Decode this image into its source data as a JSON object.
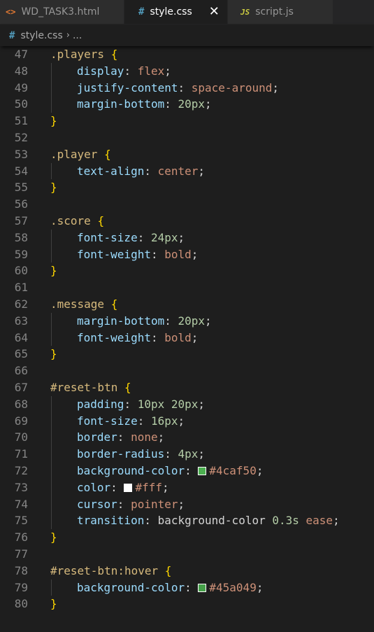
{
  "tabs": [
    {
      "label": "WD_TASK3.html",
      "icon": "html-file-icon",
      "icon_glyph": "<>",
      "active": false
    },
    {
      "label": "style.css",
      "icon": "css-file-icon",
      "icon_glyph": "#",
      "active": true,
      "close_glyph": "✕"
    },
    {
      "label": "script.js",
      "icon": "js-file-icon",
      "icon_glyph": "JS",
      "active": false
    }
  ],
  "breadcrumb": {
    "icon_glyph": "#",
    "file": "style.css",
    "separator": "›",
    "more": "..."
  },
  "lines": [
    {
      "n": "47",
      "tokens": [
        {
          "t": ".players",
          "c": "selector"
        },
        {
          "t": " ",
          "c": "punct"
        },
        {
          "t": "{",
          "c": "brace"
        }
      ]
    },
    {
      "n": "48",
      "indent": true,
      "tokens": [
        {
          "t": "display",
          "c": "prop"
        },
        {
          "t": ": ",
          "c": "punct"
        },
        {
          "t": "flex",
          "c": "val"
        },
        {
          "t": ";",
          "c": "punct"
        }
      ]
    },
    {
      "n": "49",
      "indent": true,
      "tokens": [
        {
          "t": "justify-content",
          "c": "prop"
        },
        {
          "t": ": ",
          "c": "punct"
        },
        {
          "t": "space-around",
          "c": "val"
        },
        {
          "t": ";",
          "c": "punct"
        }
      ]
    },
    {
      "n": "50",
      "indent": true,
      "tokens": [
        {
          "t": "margin-bottom",
          "c": "prop"
        },
        {
          "t": ": ",
          "c": "punct"
        },
        {
          "t": "20px",
          "c": "num"
        },
        {
          "t": ";",
          "c": "punct"
        }
      ]
    },
    {
      "n": "51",
      "tokens": [
        {
          "t": "}",
          "c": "brace"
        }
      ]
    },
    {
      "n": "52",
      "tokens": []
    },
    {
      "n": "53",
      "tokens": [
        {
          "t": ".player",
          "c": "selector"
        },
        {
          "t": " ",
          "c": "punct"
        },
        {
          "t": "{",
          "c": "brace"
        }
      ]
    },
    {
      "n": "54",
      "indent": true,
      "tokens": [
        {
          "t": "text-align",
          "c": "prop"
        },
        {
          "t": ": ",
          "c": "punct"
        },
        {
          "t": "center",
          "c": "val"
        },
        {
          "t": ";",
          "c": "punct"
        }
      ]
    },
    {
      "n": "55",
      "tokens": [
        {
          "t": "}",
          "c": "brace"
        }
      ]
    },
    {
      "n": "56",
      "tokens": []
    },
    {
      "n": "57",
      "tokens": [
        {
          "t": ".score",
          "c": "selector"
        },
        {
          "t": " ",
          "c": "punct"
        },
        {
          "t": "{",
          "c": "brace"
        }
      ]
    },
    {
      "n": "58",
      "indent": true,
      "tokens": [
        {
          "t": "font-size",
          "c": "prop"
        },
        {
          "t": ": ",
          "c": "punct"
        },
        {
          "t": "24px",
          "c": "num"
        },
        {
          "t": ";",
          "c": "punct"
        }
      ]
    },
    {
      "n": "59",
      "indent": true,
      "tokens": [
        {
          "t": "font-weight",
          "c": "prop"
        },
        {
          "t": ": ",
          "c": "punct"
        },
        {
          "t": "bold",
          "c": "val"
        },
        {
          "t": ";",
          "c": "punct"
        }
      ]
    },
    {
      "n": "60",
      "tokens": [
        {
          "t": "}",
          "c": "brace"
        }
      ]
    },
    {
      "n": "61",
      "tokens": []
    },
    {
      "n": "62",
      "tokens": [
        {
          "t": ".message",
          "c": "selector"
        },
        {
          "t": " ",
          "c": "punct"
        },
        {
          "t": "{",
          "c": "brace"
        }
      ]
    },
    {
      "n": "63",
      "indent": true,
      "tokens": [
        {
          "t": "margin-bottom",
          "c": "prop"
        },
        {
          "t": ": ",
          "c": "punct"
        },
        {
          "t": "20px",
          "c": "num"
        },
        {
          "t": ";",
          "c": "punct"
        }
      ]
    },
    {
      "n": "64",
      "indent": true,
      "tokens": [
        {
          "t": "font-weight",
          "c": "prop"
        },
        {
          "t": ": ",
          "c": "punct"
        },
        {
          "t": "bold",
          "c": "val"
        },
        {
          "t": ";",
          "c": "punct"
        }
      ]
    },
    {
      "n": "65",
      "tokens": [
        {
          "t": "}",
          "c": "brace"
        }
      ]
    },
    {
      "n": "66",
      "tokens": []
    },
    {
      "n": "67",
      "tokens": [
        {
          "t": "#reset-btn",
          "c": "selector"
        },
        {
          "t": " ",
          "c": "punct"
        },
        {
          "t": "{",
          "c": "brace"
        }
      ]
    },
    {
      "n": "68",
      "indent": true,
      "tokens": [
        {
          "t": "padding",
          "c": "prop"
        },
        {
          "t": ": ",
          "c": "punct"
        },
        {
          "t": "10px",
          "c": "num"
        },
        {
          "t": " ",
          "c": "punct"
        },
        {
          "t": "20px",
          "c": "num"
        },
        {
          "t": ";",
          "c": "punct"
        }
      ]
    },
    {
      "n": "69",
      "indent": true,
      "tokens": [
        {
          "t": "font-size",
          "c": "prop"
        },
        {
          "t": ": ",
          "c": "punct"
        },
        {
          "t": "16px",
          "c": "num"
        },
        {
          "t": ";",
          "c": "punct"
        }
      ]
    },
    {
      "n": "70",
      "indent": true,
      "tokens": [
        {
          "t": "border",
          "c": "prop"
        },
        {
          "t": ": ",
          "c": "punct"
        },
        {
          "t": "none",
          "c": "val"
        },
        {
          "t": ";",
          "c": "punct"
        }
      ]
    },
    {
      "n": "71",
      "indent": true,
      "tokens": [
        {
          "t": "border-radius",
          "c": "prop"
        },
        {
          "t": ": ",
          "c": "punct"
        },
        {
          "t": "4px",
          "c": "num"
        },
        {
          "t": ";",
          "c": "punct"
        }
      ]
    },
    {
      "n": "72",
      "indent": true,
      "tokens": [
        {
          "t": "background-color",
          "c": "prop"
        },
        {
          "t": ": ",
          "c": "punct"
        },
        {
          "swatch": "#4caf50"
        },
        {
          "t": "#4caf50",
          "c": "val"
        },
        {
          "t": ";",
          "c": "punct"
        }
      ]
    },
    {
      "n": "73",
      "indent": true,
      "tokens": [
        {
          "t": "color",
          "c": "prop"
        },
        {
          "t": ": ",
          "c": "punct"
        },
        {
          "swatch": "#ffffff"
        },
        {
          "t": "#fff",
          "c": "val"
        },
        {
          "t": ";",
          "c": "punct"
        }
      ]
    },
    {
      "n": "74",
      "indent": true,
      "tokens": [
        {
          "t": "cursor",
          "c": "prop"
        },
        {
          "t": ": ",
          "c": "punct"
        },
        {
          "t": "pointer",
          "c": "val"
        },
        {
          "t": ";",
          "c": "punct"
        }
      ]
    },
    {
      "n": "75",
      "indent": true,
      "tokens": [
        {
          "t": "transition",
          "c": "prop"
        },
        {
          "t": ": ",
          "c": "punct"
        },
        {
          "t": "background-color ",
          "c": "punct"
        },
        {
          "t": "0.3s",
          "c": "num"
        },
        {
          "t": " ",
          "c": "punct"
        },
        {
          "t": "ease",
          "c": "val"
        },
        {
          "t": ";",
          "c": "punct"
        }
      ]
    },
    {
      "n": "76",
      "tokens": [
        {
          "t": "}",
          "c": "brace"
        }
      ]
    },
    {
      "n": "77",
      "tokens": []
    },
    {
      "n": "78",
      "tokens": [
        {
          "t": "#reset-btn:hover",
          "c": "selector"
        },
        {
          "t": " ",
          "c": "punct"
        },
        {
          "t": "{",
          "c": "brace"
        }
      ]
    },
    {
      "n": "79",
      "indent": true,
      "tokens": [
        {
          "t": "background-color",
          "c": "prop"
        },
        {
          "t": ": ",
          "c": "punct"
        },
        {
          "swatch": "#45a049"
        },
        {
          "t": "#45a049",
          "c": "val"
        },
        {
          "t": ";",
          "c": "punct"
        }
      ]
    },
    {
      "n": "80",
      "tokens": [
        {
          "t": "}",
          "c": "brace"
        }
      ]
    }
  ]
}
